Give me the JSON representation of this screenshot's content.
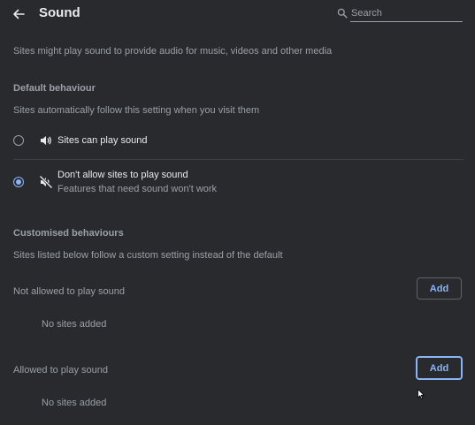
{
  "header": {
    "title": "Sound",
    "back_icon": "arrow-back-icon",
    "search_placeholder": "Search",
    "search_value": ""
  },
  "description": "Sites might play sound to provide audio for music, videos and other media",
  "default_behaviour": {
    "heading": "Default behaviour",
    "description": "Sites automatically follow this setting when you visit them",
    "options": [
      {
        "label": "Sites can play sound",
        "sublabel": "",
        "icon": "volume-icon",
        "selected": false
      },
      {
        "label": "Don't allow sites to play sound",
        "sublabel": "Features that need sound won't work",
        "icon": "volume-off-icon",
        "selected": true
      }
    ]
  },
  "customised_behaviours": {
    "heading": "Customised behaviours",
    "description": "Sites listed below follow a custom setting instead of the default",
    "not_allowed": {
      "label": "Not allowed to play sound",
      "add_label": "Add",
      "empty_text": "No sites added"
    },
    "allowed": {
      "label": "Allowed to play sound",
      "add_label": "Add",
      "empty_text": "No sites added"
    }
  },
  "colors": {
    "background": "#292a2d",
    "accent": "#8ab4f8",
    "text_primary": "#e8eaed",
    "text_secondary": "#9aa0a6"
  }
}
